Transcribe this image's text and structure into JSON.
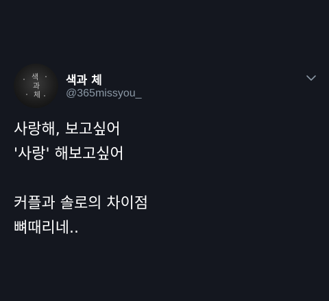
{
  "tweet": {
    "display_name": "색과 체",
    "handle": "@365missyou_",
    "text": "사랑해, 보고싶어\n'사랑' 해보고싶어\n\n커플과 솔로의 차이점\n뼈때리네..",
    "avatar": {
      "icon": "profile-avatar",
      "glyphs": [
        "색",
        "과",
        "체"
      ]
    },
    "more_icon": "chevron-down-icon"
  },
  "colors": {
    "background": "#14171f",
    "text": "#ffffff",
    "secondary_text": "#8b98a5"
  }
}
